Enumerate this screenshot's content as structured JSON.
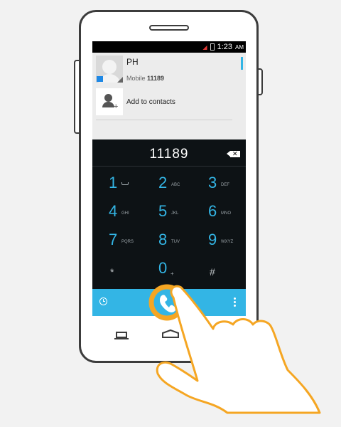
{
  "status_bar": {
    "time": "1:23",
    "ampm": "AM"
  },
  "contact_match": {
    "name": "PH",
    "type": "Mobile",
    "number": "11189"
  },
  "add_contact": {
    "label": "Add to contacts"
  },
  "dial_display": {
    "number": "11189"
  },
  "keypad": [
    {
      "digit": "1",
      "letters": ""
    },
    {
      "digit": "2",
      "letters": "ABC"
    },
    {
      "digit": "3",
      "letters": "DEF"
    },
    {
      "digit": "4",
      "letters": "GHI"
    },
    {
      "digit": "5",
      "letters": "JKL"
    },
    {
      "digit": "6",
      "letters": "MNO"
    },
    {
      "digit": "7",
      "letters": "PQRS"
    },
    {
      "digit": "8",
      "letters": "TUV"
    },
    {
      "digit": "9",
      "letters": "WXYZ"
    },
    {
      "digit": "*",
      "letters": ""
    },
    {
      "digit": "0",
      "letters": "+"
    },
    {
      "digit": "#",
      "letters": ""
    }
  ],
  "colors": {
    "accent": "#33b5e5",
    "highlight_ring": "#f5a623",
    "keypad_bg": "#0d1215"
  }
}
